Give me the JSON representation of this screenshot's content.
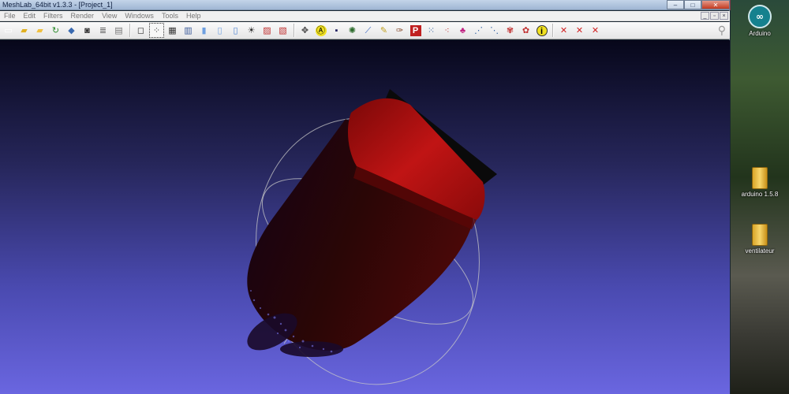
{
  "window": {
    "title": "MeshLab_64bit v1.3.3 - [Project_1]",
    "controls": {
      "minimize": "–",
      "maximize": "□",
      "close": "✕"
    }
  },
  "menu": {
    "items": [
      "File",
      "Edit",
      "Filters",
      "Render",
      "View",
      "Windows",
      "Tools",
      "Help"
    ],
    "mdi_controls": [
      "_",
      "▫",
      "×"
    ]
  },
  "toolbar": {
    "icons": [
      {
        "name": "new-project-icon",
        "glyph": "▭",
        "color": "#ffffff"
      },
      {
        "name": "open-project-icon",
        "glyph": "▰",
        "color": "#e0b020"
      },
      {
        "name": "open-mesh-icon",
        "glyph": "▰",
        "color": "#f0c040"
      },
      {
        "name": "reload-icon",
        "glyph": "↻",
        "color": "#2a8a2a"
      },
      {
        "name": "export-icon",
        "glyph": "◆",
        "color": "#3a6ab0"
      },
      {
        "name": "snapshot-icon",
        "glyph": "◙",
        "color": "#333333"
      },
      {
        "name": "layers-icon",
        "glyph": "≣",
        "color": "#555555"
      },
      {
        "name": "show-layer-dialog-icon",
        "glyph": "▤",
        "color": "#777777"
      }
    ],
    "render_icons": [
      {
        "name": "bounding-box-icon",
        "glyph": "◻",
        "color": "#333333",
        "active": false
      },
      {
        "name": "points-icon",
        "glyph": "⁘",
        "color": "#333333",
        "active": true
      },
      {
        "name": "wireframe-icon",
        "glyph": "▦",
        "color": "#333333",
        "active": false
      },
      {
        "name": "hidden-lines-icon",
        "glyph": "▥",
        "color": "#3a5a9a",
        "active": false
      },
      {
        "name": "flat-lines-icon",
        "glyph": "▮",
        "color": "#6fa0e0",
        "active": false
      },
      {
        "name": "flat-icon",
        "glyph": "▯",
        "color": "#6fa0e0",
        "active": false
      },
      {
        "name": "smooth-icon",
        "glyph": "▯",
        "color": "#4a80d0",
        "active": false
      },
      {
        "name": "light-icon",
        "glyph": "☀",
        "color": "#333333",
        "active": false
      },
      {
        "name": "double-side-icon",
        "glyph": "▨",
        "color": "#c03030",
        "active": false
      },
      {
        "name": "back-face-icon",
        "glyph": "▧",
        "color": "#c03030",
        "active": false
      }
    ],
    "edit_icons": [
      {
        "name": "manipulator-icon",
        "glyph": "✥",
        "color": "#444444"
      },
      {
        "name": "annotation-icon",
        "glyph": "Ⓐ",
        "color": "#000000"
      },
      {
        "name": "raster-icon",
        "glyph": "▪",
        "color": "#202060"
      },
      {
        "name": "texture-icon",
        "glyph": "✺",
        "color": "#2a6a2a"
      },
      {
        "name": "measure-icon",
        "glyph": "⟋",
        "color": "#3060c0"
      },
      {
        "name": "paint-icon",
        "glyph": "✎",
        "color": "#c0a020"
      },
      {
        "name": "brush-icon",
        "glyph": "✑",
        "color": "#804020"
      },
      {
        "name": "pickpoints-icon",
        "glyph": "P",
        "color": "#ffffff"
      },
      {
        "name": "select-vertices-icon",
        "glyph": "⁙",
        "color": "#3060a0"
      },
      {
        "name": "select-faces-icon",
        "glyph": "⁖",
        "color": "#c03030"
      },
      {
        "name": "color-icon",
        "glyph": "♣",
        "color": "#c02080"
      },
      {
        "name": "point-select-icon",
        "glyph": "⋰",
        "color": "#3060a0"
      },
      {
        "name": "fit-icon",
        "glyph": "⋱",
        "color": "#3060a0"
      },
      {
        "name": "align-icon",
        "glyph": "✾",
        "color": "#c03030"
      },
      {
        "name": "select-connected-icon",
        "glyph": "✿",
        "color": "#c03030"
      },
      {
        "name": "info-icon",
        "glyph": "i",
        "color": "#000000"
      }
    ],
    "delete_icons": [
      {
        "name": "delete-vertices-icon",
        "glyph": "✕",
        "color": "#d02020"
      },
      {
        "name": "delete-faces-icon",
        "glyph": "✕",
        "color": "#d02020"
      },
      {
        "name": "delete-faces-vertices-icon",
        "glyph": "✕",
        "color": "#d02020"
      }
    ],
    "search_glyph": "⚲"
  },
  "desktop": {
    "icons": [
      {
        "name": "arduino-desktop-icon",
        "label": "Arduino",
        "kind": "arduino",
        "glyph": "∞"
      },
      {
        "name": "arduino-folder-icon",
        "label": "arduino 1.5.8",
        "kind": "folder"
      },
      {
        "name": "ventilateur-folder-icon",
        "label": "ventilateur",
        "kind": "folder"
      }
    ]
  },
  "colors": {
    "viewport_top": "#07071a",
    "viewport_bottom": "#6a66e0",
    "mesh_red": "#b01010",
    "mesh_dark": "#2a0606",
    "trackball": "#c8c8c8"
  }
}
